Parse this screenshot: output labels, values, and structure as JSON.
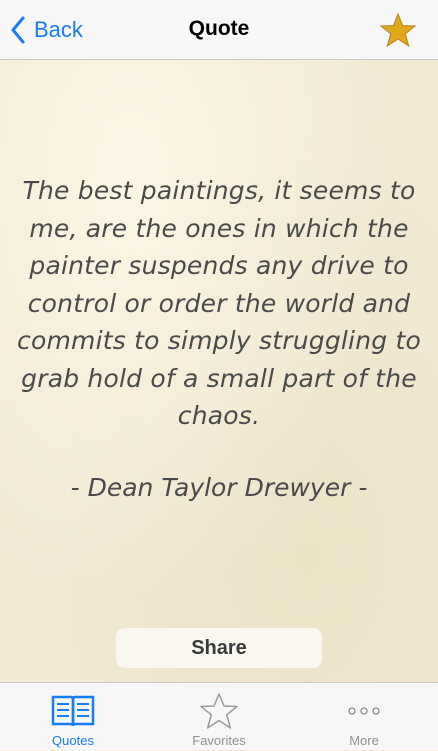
{
  "navbar": {
    "back_label": "Back",
    "title": "Quote",
    "favorite_icon": "star-filled-icon",
    "accent_color": "#1a7cf5",
    "star_color": "#e0a91c"
  },
  "quote": {
    "text": "The best paintings, it seems to me, are the ones in which the painter suspends any drive to control or order the world and commits to simply struggling to grab hold of a small part of the chaos.",
    "author": "-  Dean Taylor Drewyer  -"
  },
  "share_label": "Share",
  "tabbar": {
    "tabs": [
      {
        "label": "Quotes",
        "icon": "open-book-icon",
        "active": true
      },
      {
        "label": "Favorites",
        "icon": "star-outline-icon",
        "active": false
      },
      {
        "label": "More",
        "icon": "more-dots-icon",
        "active": false
      }
    ]
  }
}
